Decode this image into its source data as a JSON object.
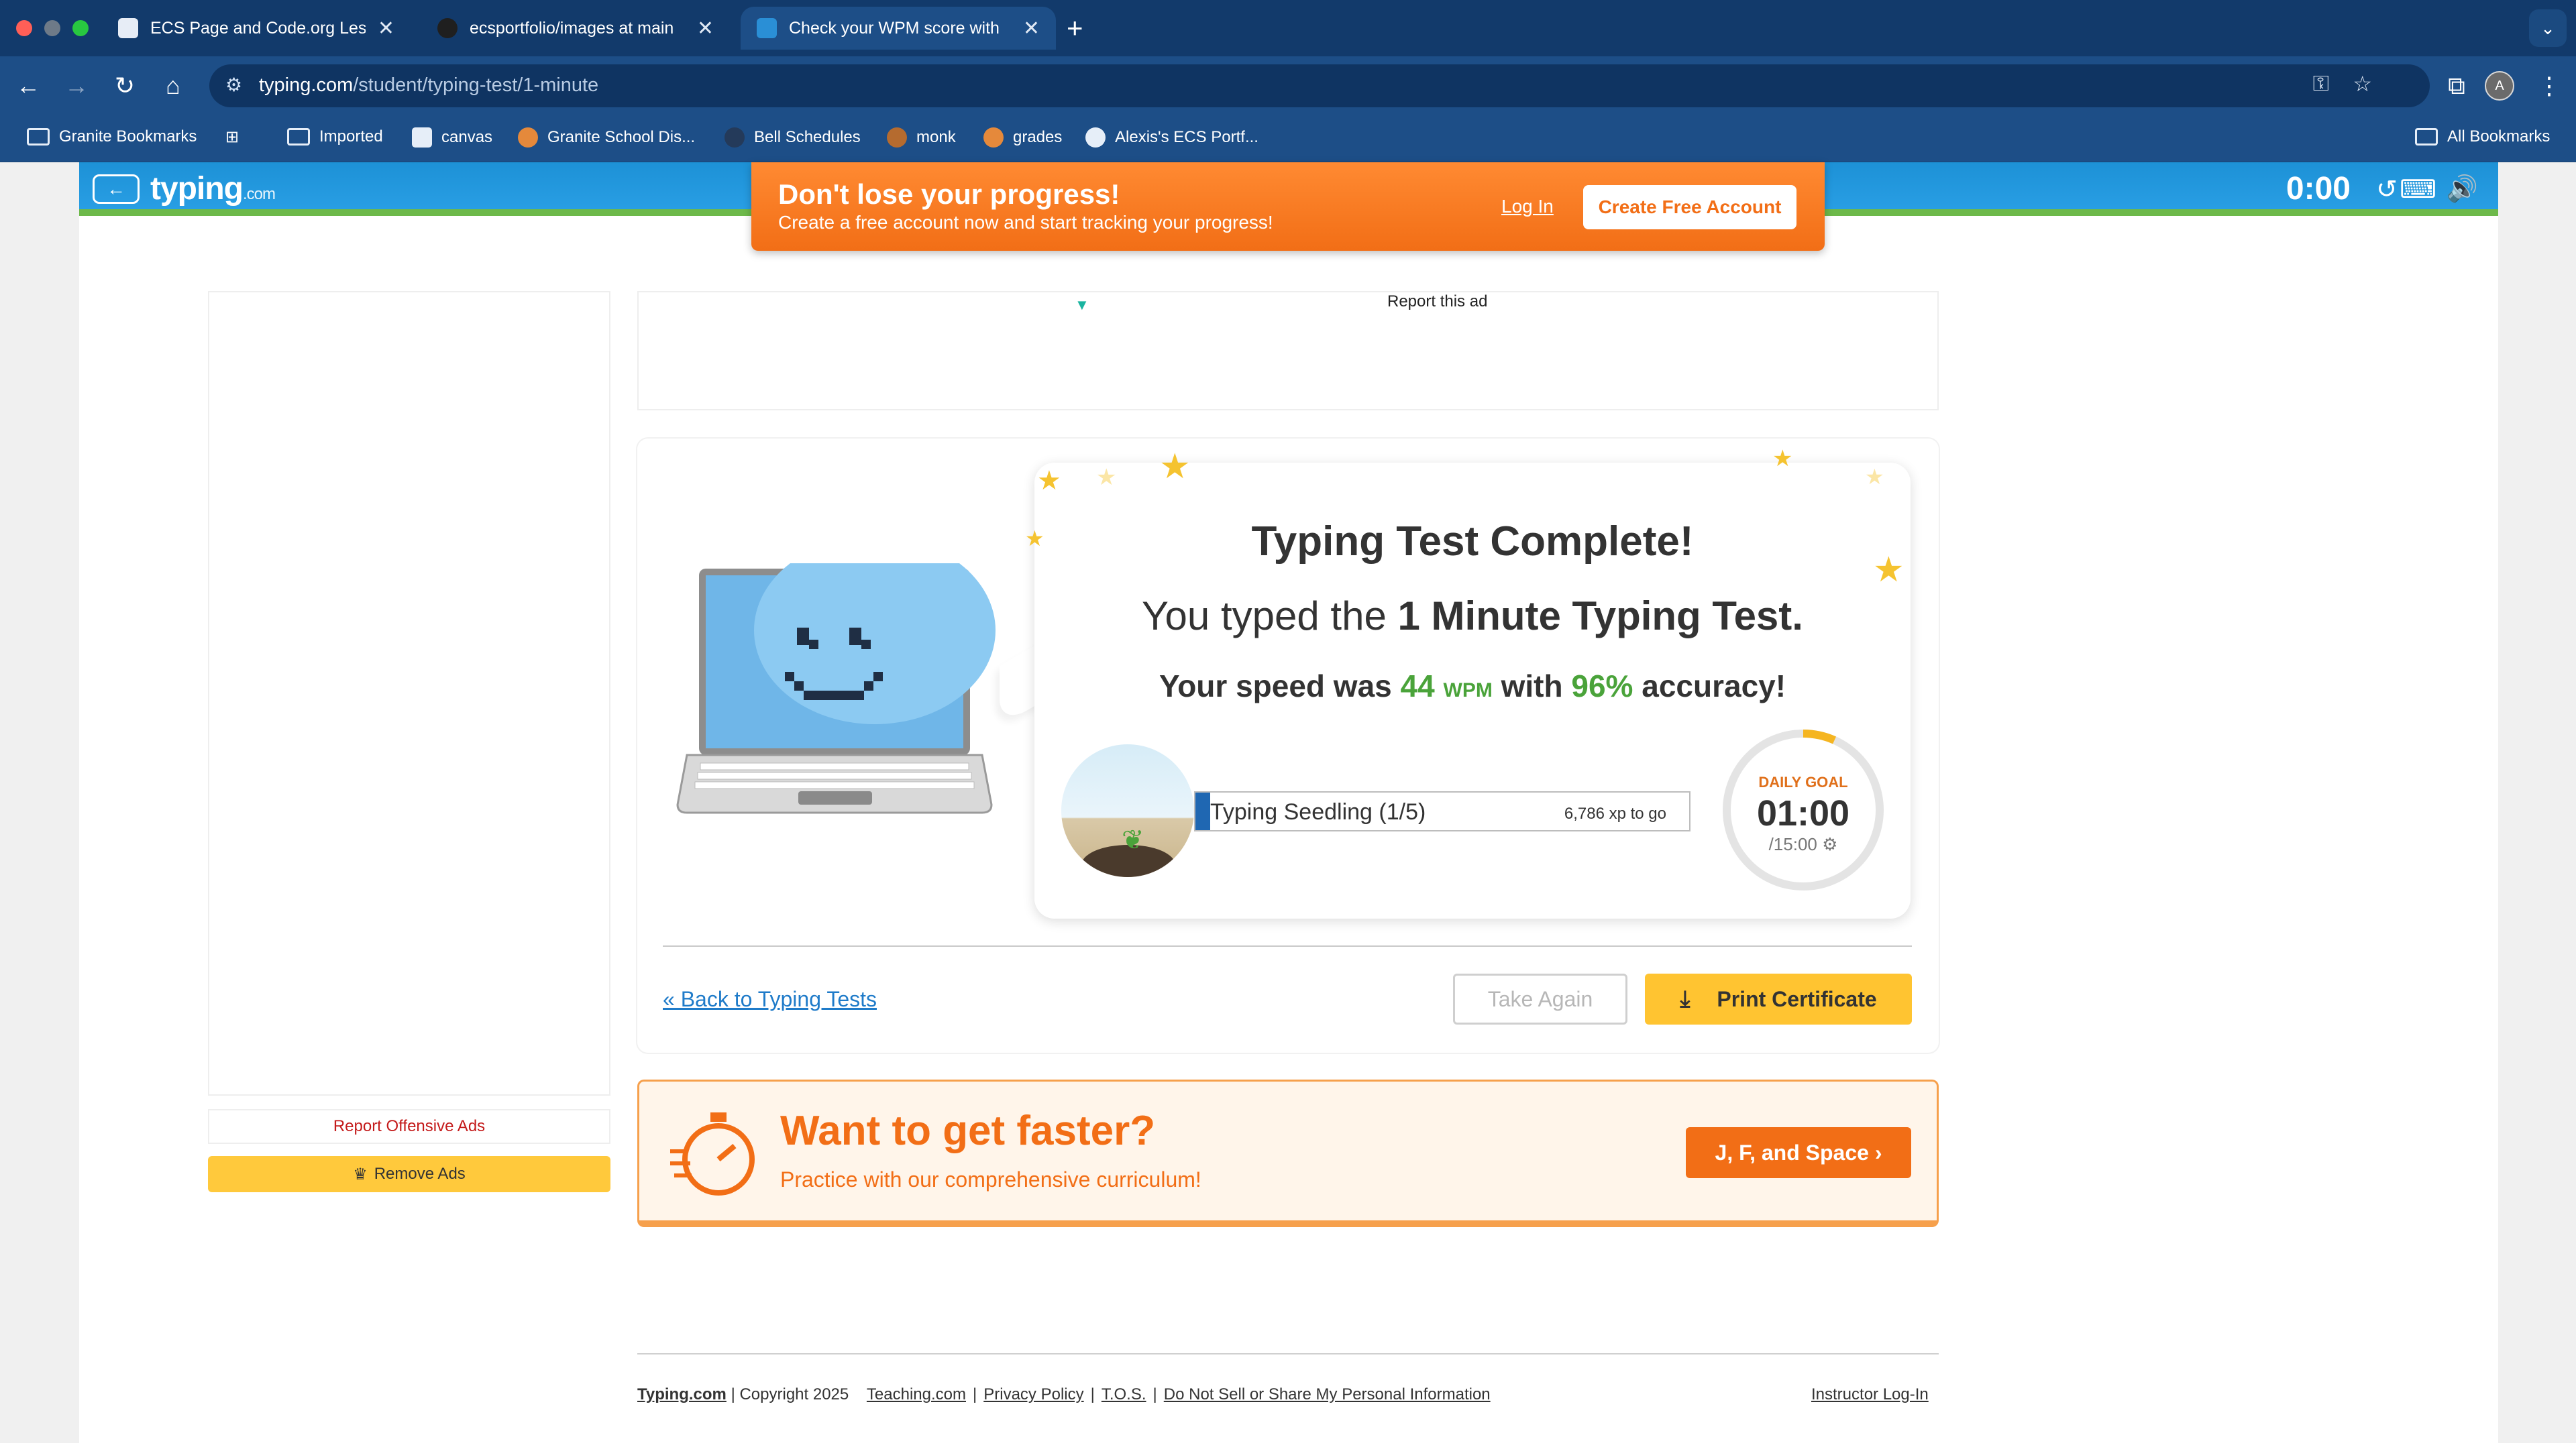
{
  "browser": {
    "tabs": [
      {
        "title": "ECS Page and Code.org Less",
        "active": false
      },
      {
        "title": "ecsportfolio/images at main",
        "active": false
      },
      {
        "title": "Check your WPM score with",
        "active": true
      }
    ],
    "url_host": "typing.com",
    "url_path": "/student/typing-test/1-minute",
    "profile_initial": "A",
    "bookmarks": [
      "Granite Bookmarks",
      "Imported",
      "canvas",
      "Granite School Dis...",
      "Bell Schedules",
      "monk",
      "grades",
      "Alexis's ECS Portf..."
    ],
    "all_bookmarks": "All Bookmarks"
  },
  "site": {
    "logo": "typing",
    "logo_suffix": ".com",
    "timer": "0:00"
  },
  "banner": {
    "title": "Don't lose your progress!",
    "subtitle": "Create a free account now and start tracking your progress!",
    "login": "Log In",
    "create": "Create Free Account"
  },
  "ads": {
    "report_ad": "Report this ad",
    "report_offensive": "Report Offensive Ads",
    "remove_ads": "Remove Ads"
  },
  "result": {
    "heading": "Typing Test Complete!",
    "typed_prefix": "You typed the",
    "typed_test": "1 Minute Typing Test.",
    "speed_prefix": "Your speed was",
    "wpm_value": "44",
    "wpm_unit": "WPM",
    "with_text": "with",
    "accuracy": "96%",
    "accuracy_suffix": "accuracy!",
    "level": "Typing Seedling (1/5)",
    "xp_to_go": "6,786 xp to go",
    "xp_progress": 0.03,
    "goal_label": "DAILY GOAL",
    "goal_time": "01:00",
    "goal_total": "/15:00",
    "goal_progress": 0.067
  },
  "actions": {
    "back": "« Back to Typing Tests",
    "take_again": "Take Again",
    "print": "Print Certificate"
  },
  "promo": {
    "title": "Want to get faster?",
    "subtitle": "Practice with our comprehensive curriculum!",
    "cta": "J, F, and Space ›"
  },
  "footer": {
    "brand": "Typing.com",
    "copyright": "| Copyright 2025",
    "teaching": "Teaching.com",
    "privacy": "Privacy Policy",
    "tos": "T.O.S.",
    "dnsmpi": "Do Not Sell or Share My Personal Information",
    "instructor": "Instructor Log-In"
  },
  "colors": {
    "accent_orange": "#f26e16",
    "accent_blue": "#1d91d6",
    "success_green": "#4aa33a",
    "button_yellow": "#ffc431"
  }
}
